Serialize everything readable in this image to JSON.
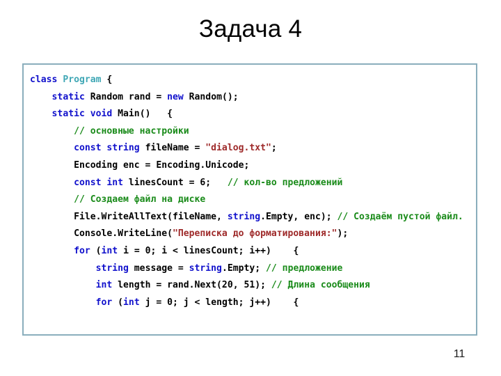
{
  "slide": {
    "title": "Задача 4",
    "page_number": "11",
    "border_color": "#8aaebc",
    "background_color": "#ffffff"
  },
  "syntax_colors": {
    "keyword": "#1111cc",
    "type": "#3fa7b5",
    "string": "#9e2a2a",
    "comment": "#1a8b1a",
    "plain": "#000000"
  },
  "code": {
    "language": "csharp",
    "lines": [
      {
        "indent": 0,
        "tokens": [
          {
            "t": "class ",
            "k": "kw"
          },
          {
            "t": "Program",
            "k": "type"
          },
          {
            "t": " {",
            "k": "pln"
          }
        ]
      },
      {
        "indent": 1,
        "tokens": [
          {
            "t": "static ",
            "k": "kw"
          },
          {
            "t": "Random rand = ",
            "k": "pln"
          },
          {
            "t": "new ",
            "k": "kw"
          },
          {
            "t": "Random();",
            "k": "pln"
          }
        ]
      },
      {
        "indent": 1,
        "tokens": [
          {
            "t": "static void ",
            "k": "kw"
          },
          {
            "t": "Main()   {",
            "k": "pln"
          }
        ]
      },
      {
        "indent": 2,
        "tokens": [
          {
            "t": "// основные настройки",
            "k": "com"
          }
        ]
      },
      {
        "indent": 2,
        "tokens": [
          {
            "t": "const string ",
            "k": "kw"
          },
          {
            "t": "fileName = ",
            "k": "pln"
          },
          {
            "t": "\"dialog.txt\"",
            "k": "str"
          },
          {
            "t": ";",
            "k": "pln"
          }
        ]
      },
      {
        "indent": 2,
        "tokens": [
          {
            "t": "Encoding enc = Encoding.Unicode;",
            "k": "pln"
          }
        ]
      },
      {
        "indent": 2,
        "tokens": [
          {
            "t": "const int ",
            "k": "kw"
          },
          {
            "t": "linesCount = 6;   ",
            "k": "pln"
          },
          {
            "t": "// кол-во предложений",
            "k": "com"
          }
        ]
      },
      {
        "indent": 2,
        "tokens": [
          {
            "t": "// Создаем файл на диске",
            "k": "com"
          }
        ]
      },
      {
        "indent": 2,
        "tokens": [
          {
            "t": "File.WriteAllText(fileName, ",
            "k": "pln"
          },
          {
            "t": "string",
            "k": "kw"
          },
          {
            "t": ".Empty, enc); ",
            "k": "pln"
          },
          {
            "t": "// Создаём пустой файл.",
            "k": "com"
          }
        ]
      },
      {
        "indent": 2,
        "tokens": [
          {
            "t": "Console.WriteLine(",
            "k": "pln"
          },
          {
            "t": "\"Переписка до форматирования:\"",
            "k": "str"
          },
          {
            "t": ");",
            "k": "pln"
          }
        ]
      },
      {
        "indent": 2,
        "tokens": [
          {
            "t": "for ",
            "k": "kw"
          },
          {
            "t": "(",
            "k": "pln"
          },
          {
            "t": "int ",
            "k": "kw"
          },
          {
            "t": "i = 0; i < linesCount; i++)    {",
            "k": "pln"
          }
        ]
      },
      {
        "indent": 3,
        "tokens": [
          {
            "t": "string ",
            "k": "kw"
          },
          {
            "t": "message = ",
            "k": "pln"
          },
          {
            "t": "string",
            "k": "kw"
          },
          {
            "t": ".Empty; ",
            "k": "pln"
          },
          {
            "t": "// предложение",
            "k": "com"
          }
        ]
      },
      {
        "indent": 3,
        "tokens": [
          {
            "t": "int ",
            "k": "kw"
          },
          {
            "t": "length = rand.Next(20, 51); ",
            "k": "pln"
          },
          {
            "t": "// Длина сообщения",
            "k": "com"
          }
        ]
      },
      {
        "indent": 3,
        "tokens": [
          {
            "t": "for ",
            "k": "kw"
          },
          {
            "t": "(",
            "k": "pln"
          },
          {
            "t": "int ",
            "k": "kw"
          },
          {
            "t": "j = 0; j < length; j++)    {",
            "k": "pln"
          }
        ]
      }
    ]
  }
}
